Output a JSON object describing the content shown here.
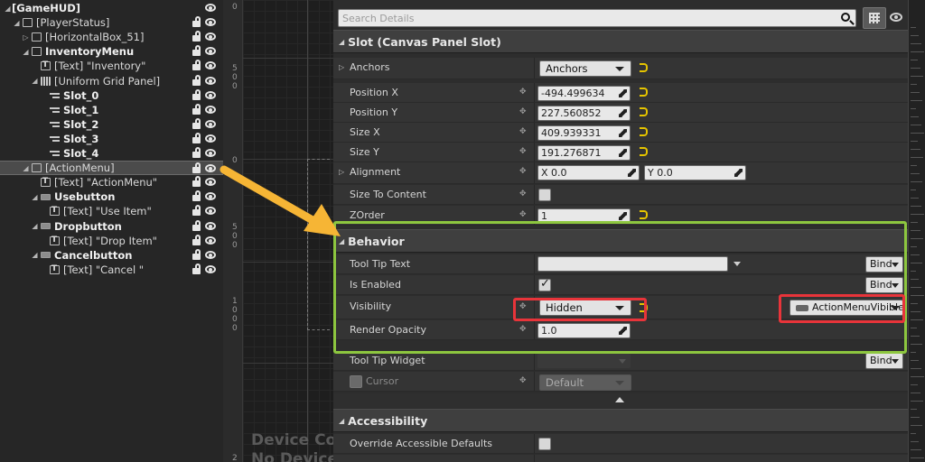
{
  "hierarchy": [
    {
      "label": "[GameHUD]",
      "depth": 0,
      "icon": "none",
      "expand": "open",
      "bold": true
    },
    {
      "label": "[PlayerStatus]",
      "depth": 1,
      "icon": "canvas",
      "expand": "open",
      "bold": false
    },
    {
      "label": "[HorizontalBox_51]",
      "depth": 2,
      "icon": "hbox",
      "expand": "closed",
      "bold": false
    },
    {
      "label": "InventoryMenu",
      "depth": 2,
      "icon": "panel",
      "expand": "open",
      "bold": true
    },
    {
      "label": "[Text] \"Inventory\"",
      "depth": 3,
      "icon": "text",
      "expand": "none",
      "bold": false
    },
    {
      "label": "[Uniform Grid Panel]",
      "depth": 3,
      "icon": "grid",
      "expand": "open",
      "bold": false
    },
    {
      "label": "Slot_0",
      "depth": 4,
      "icon": "slot",
      "expand": "none",
      "bold": true
    },
    {
      "label": "Slot_1",
      "depth": 4,
      "icon": "slot",
      "expand": "none",
      "bold": true
    },
    {
      "label": "Slot_2",
      "depth": 4,
      "icon": "slot",
      "expand": "none",
      "bold": true
    },
    {
      "label": "Slot_3",
      "depth": 4,
      "icon": "slot",
      "expand": "none",
      "bold": true
    },
    {
      "label": "Slot_4",
      "depth": 4,
      "icon": "slot",
      "expand": "none",
      "bold": true
    },
    {
      "label": "[ActionMenu]",
      "depth": 2,
      "icon": "panel",
      "expand": "open",
      "bold": false,
      "selected": true
    },
    {
      "label": "[Text] \"ActionMenu\"",
      "depth": 3,
      "icon": "text",
      "expand": "none",
      "bold": false
    },
    {
      "label": "Usebutton",
      "depth": 3,
      "icon": "button",
      "expand": "open",
      "bold": true
    },
    {
      "label": "[Text] \"Use Item\"",
      "depth": 4,
      "icon": "text",
      "expand": "none",
      "bold": false
    },
    {
      "label": "Dropbutton",
      "depth": 3,
      "icon": "button",
      "expand": "open",
      "bold": true
    },
    {
      "label": "[Text] \"Drop Item\"",
      "depth": 4,
      "icon": "text",
      "expand": "none",
      "bold": false
    },
    {
      "label": "Cancelbutton",
      "depth": 3,
      "icon": "button",
      "expand": "open",
      "bold": true
    },
    {
      "label": "[Text] \"Cancel \"",
      "depth": 4,
      "icon": "text",
      "expand": "none",
      "bold": false
    }
  ],
  "canvas": {
    "ruler_labels": [
      "0",
      "5",
      "0",
      "0",
      "0",
      "5",
      "0",
      "0",
      "1",
      "0",
      "0",
      "0",
      "2"
    ],
    "device_text_1": "Device Co",
    "device_text_2": "No Device"
  },
  "details": {
    "search_placeholder": "Search Details",
    "slot_section": "Slot (Canvas Panel Slot)",
    "anchors_label": "Anchors",
    "anchors_value": "Anchors",
    "position_x_label": "Position X",
    "position_x": "-494.499634",
    "position_y_label": "Position Y",
    "position_y": "227.560852",
    "size_x_label": "Size X",
    "size_x": "409.939331",
    "size_y_label": "Size Y",
    "size_y": "191.276871",
    "alignment_label": "Alignment",
    "alignment_x": "X  0.0",
    "alignment_y": "Y  0.0",
    "size_to_content_label": "Size To Content",
    "zorder_label": "ZOrder",
    "zorder": "1",
    "behavior_section": "Behavior",
    "tooltip_label": "Tool Tip Text",
    "tooltip_value": "",
    "is_enabled_label": "Is Enabled",
    "visibility_label": "Visibility",
    "visibility_value": "Hidden",
    "visibility_binding": "ActionMenuVibible",
    "render_opacity_label": "Render Opacity",
    "render_opacity": "1.0",
    "tooltip_widget_label": "Tool Tip Widget",
    "cursor_label": "Cursor",
    "cursor_value": "Default",
    "accessibility_section": "Accessibility",
    "override_accessible_label": "Override Accessible Defaults",
    "bind_label": "Bind"
  },
  "colors": {
    "highlight_green": "#8dc63f",
    "highlight_red": "#e8343a",
    "arrow": "#f6b535",
    "reset_yellow": "#e5c400"
  }
}
